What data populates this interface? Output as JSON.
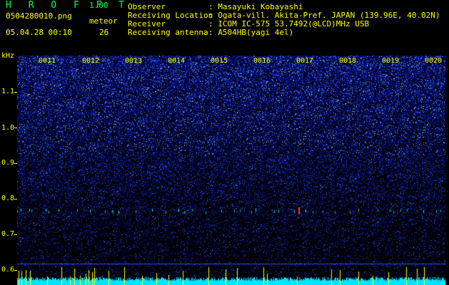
{
  "app": {
    "title": "H R O F F T",
    "version": "1.00"
  },
  "file": {
    "name": "0504280010.png",
    "datetime": "05.04.28 00:10"
  },
  "meteor": {
    "label": "meteor",
    "count": "26"
  },
  "info": [
    {
      "label": "Observer",
      "value": ": Masayuki Kobayashi"
    },
    {
      "label": "Receiving Location",
      "value": ": Ogata-vill. Akita-Pref. JAPAN (139.96E, 40.02N)"
    },
    {
      "label": "Receiver",
      "value": ": ICOM IC-575 53.7492(@LCD)MHz USB"
    },
    {
      "label": "Receiving antenna",
      "value": ": A504HB(yagi 4el)"
    }
  ],
  "yaxis": {
    "unit": "kHz",
    "ticks": [
      "1.1",
      "1.0",
      "0.9",
      "0.8",
      "0.7",
      "0.6"
    ]
  },
  "time_marks": [
    "0011",
    "0012",
    "0013",
    "0014",
    "0015",
    "0016",
    "0017",
    "0018",
    "0019",
    "0020"
  ],
  "colors": {
    "background": "#000000",
    "label_yellow": "#ffff00",
    "title_green": "#00ff44",
    "spectrum_blue": "#1a2cff",
    "meteor_echo": "#00ffff",
    "strong_echo": "#ff3030"
  }
}
